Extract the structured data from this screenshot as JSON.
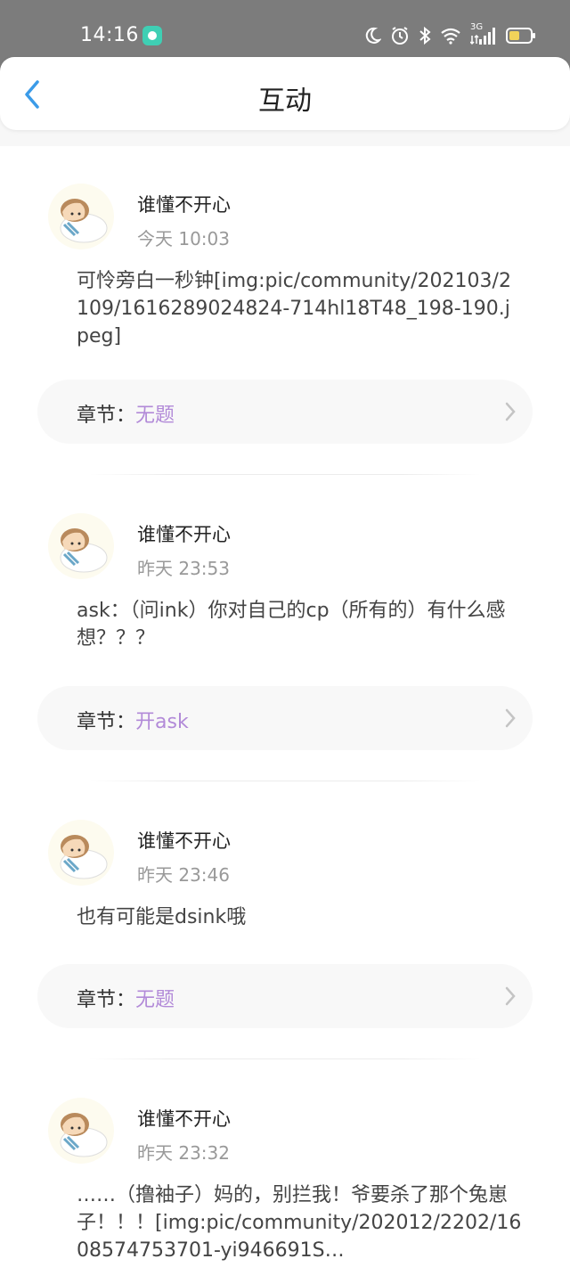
{
  "status": {
    "time": "14:16",
    "network": "3G"
  },
  "header": {
    "title": "互动"
  },
  "posts": [
    {
      "username": "谁懂不开心",
      "time": "今天 10:03",
      "content": "可怜旁白一秒钟[img:pic/community/202103/2109/1616289024824-714hl18T48_198-190.jpeg]",
      "chapter_label": "章节：",
      "chapter_name": "无题"
    },
    {
      "username": "谁懂不开心",
      "time": "昨天 23:53",
      "content": "ask：（问ink）你对自己的cp（所有的）有什么感想？？？",
      "chapter_label": "章节：",
      "chapter_name": "开ask"
    },
    {
      "username": "谁懂不开心",
      "time": "昨天 23:46",
      "content": "也有可能是dsink哦",
      "chapter_label": "章节：",
      "chapter_name": "无题"
    },
    {
      "username": "谁懂不开心",
      "time": "昨天 23:32",
      "content": "……（撸袖子）妈的，别拦我！爷要杀了那个兔崽子！！！[img:pic/community/202012/2202/1608574753701-yi946691S…"
    }
  ]
}
